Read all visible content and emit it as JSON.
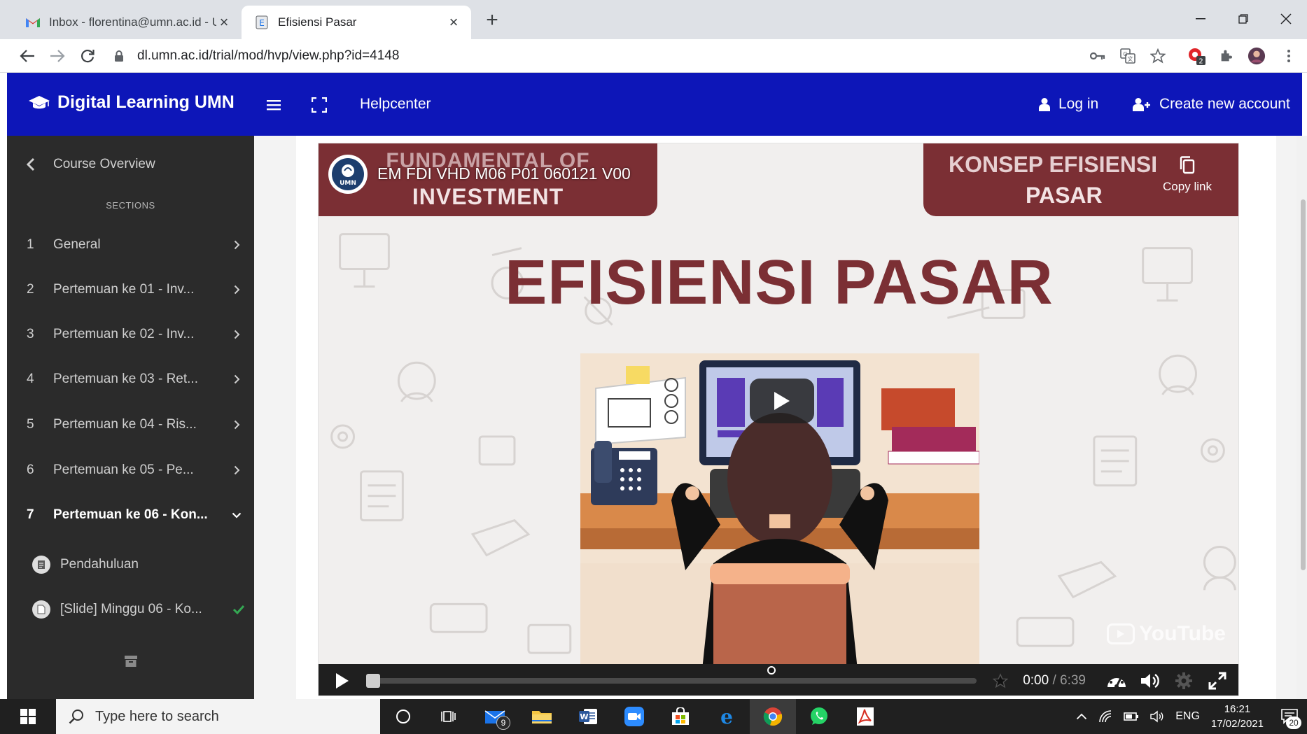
{
  "browser": {
    "tabs": [
      {
        "title": "Inbox - florentina@umn.ac.id - U",
        "active": false
      },
      {
        "title": "Efisiensi Pasar",
        "active": true
      }
    ],
    "url": "dl.umn.ac.id/trial/mod/hvp/view.php?id=4148",
    "extension_badge": "2"
  },
  "navbar": {
    "brand": "Digital Learning UMN",
    "helpcenter": "Helpcenter",
    "login": "Log in",
    "create_account": "Create new account",
    "bg_color": "#0d16b8"
  },
  "sidebar": {
    "course_overview": "Course Overview",
    "sections_heading": "SECTIONS",
    "sections": [
      {
        "num": "1",
        "label": "General"
      },
      {
        "num": "2",
        "label": "Pertemuan ke 01 - Inv..."
      },
      {
        "num": "3",
        "label": "Pertemuan ke 02 - Inv..."
      },
      {
        "num": "4",
        "label": "Pertemuan ke 03 - Ret..."
      },
      {
        "num": "5",
        "label": "Pertemuan ke 04 - Ris..."
      },
      {
        "num": "6",
        "label": "Pertemuan ke 05 - Pe..."
      },
      {
        "num": "7",
        "label": "Pertemuan ke 06 - Kon..."
      }
    ],
    "activities": [
      {
        "label": "Pendahuluan",
        "completed": false
      },
      {
        "label": "[Slide] Minggu 06 - Ko...",
        "completed": true
      }
    ]
  },
  "video": {
    "banner_left_top": "FUNDAMENTAL OF",
    "banner_left_bottom": "INVESTMENT",
    "banner_right_top": "KONSEP EFISIENSI",
    "banner_right_bottom": "PASAR",
    "youtube_title": "EM FDI VHD M06 P01 060121 V00",
    "logo_text": "UMN",
    "copy_link": "Copy link",
    "headline": "EFISIENSI PASAR",
    "watermark": "YouTube",
    "current_time": "0:00",
    "duration": "6:39",
    "progress_fraction": 0,
    "accent": "#7b2f34"
  },
  "taskbar": {
    "search_placeholder": "Type here to search",
    "mail_badge": "9",
    "language": "ENG",
    "time": "16:21",
    "date": "17/02/2021",
    "notification_count": "20"
  }
}
